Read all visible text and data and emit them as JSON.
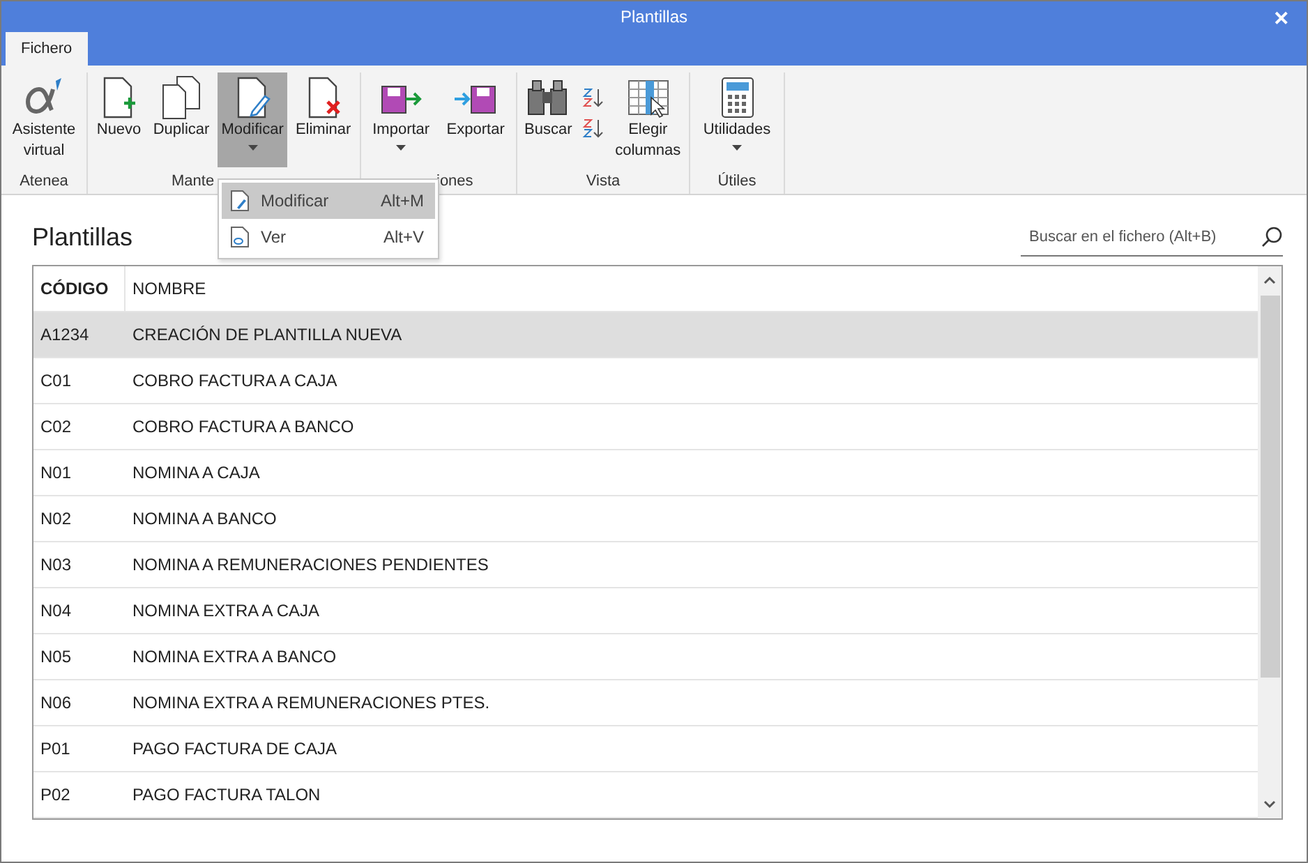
{
  "window": {
    "title": "Plantillas",
    "close": "✕"
  },
  "tabs": [
    {
      "label": "Fichero",
      "selected": true
    }
  ],
  "ribbon": {
    "groups": [
      {
        "label": "Atenea",
        "buttons": [
          {
            "kind": "alpha",
            "label": "Asistente virtual",
            "pressed": false,
            "dropdown": false
          }
        ]
      },
      {
        "label": "Mante",
        "buttons": [
          {
            "kind": "new",
            "label": "Nuevo",
            "pressed": false,
            "dropdown": false
          },
          {
            "kind": "copy",
            "label": "Duplicar",
            "pressed": false,
            "dropdown": false
          },
          {
            "kind": "edit",
            "label": "Modificar",
            "pressed": true,
            "dropdown": true
          },
          {
            "kind": "delete",
            "label": "Eliminar",
            "pressed": false,
            "dropdown": false
          }
        ]
      },
      {
        "label": "iones",
        "buttons": [
          {
            "kind": "import",
            "label": "Importar",
            "pressed": false,
            "dropdown": true
          },
          {
            "kind": "export",
            "label": "Exportar",
            "pressed": false,
            "dropdown": false
          }
        ]
      },
      {
        "label": "Vista",
        "buttons": [
          {
            "kind": "binoculars",
            "label": "Buscar",
            "pressed": false,
            "dropdown": false
          },
          {
            "kind": "sort"
          },
          {
            "kind": "columns",
            "label": "Elegir columnas",
            "pressed": false,
            "dropdown": false
          }
        ]
      },
      {
        "label": "Útiles",
        "buttons": [
          {
            "kind": "calculator",
            "label": "Utilidades",
            "pressed": false,
            "dropdown": true
          }
        ]
      }
    ]
  },
  "menu": [
    {
      "kind": "edit",
      "label": "Modificar",
      "shortcut": "Alt+M",
      "selected": true
    },
    {
      "kind": "view",
      "label": "Ver",
      "shortcut": "Alt+V",
      "selected": false
    }
  ],
  "heading": "Plantillas",
  "search": {
    "placeholder": "Buscar en el fichero (Alt+B)"
  },
  "table": {
    "columns": [
      "CÓDIGO",
      "NOMBRE"
    ],
    "rows": [
      {
        "code": "A1234",
        "name": "CREACIÓN DE PLANTILLA NUEVA",
        "selected": true
      },
      {
        "code": "C01",
        "name": "COBRO FACTURA A CAJA",
        "selected": false
      },
      {
        "code": "C02",
        "name": "COBRO FACTURA A BANCO",
        "selected": false
      },
      {
        "code": "N01",
        "name": "NOMINA A CAJA",
        "selected": false
      },
      {
        "code": "N02",
        "name": "NOMINA A BANCO",
        "selected": false
      },
      {
        "code": "N03",
        "name": "NOMINA A REMUNERACIONES PENDIENTES",
        "selected": false
      },
      {
        "code": "N04",
        "name": "NOMINA EXTRA A CAJA",
        "selected": false
      },
      {
        "code": "N05",
        "name": "NOMINA EXTRA A BANCO",
        "selected": false
      },
      {
        "code": "N06",
        "name": "NOMINA EXTRA A REMUNERACIONES PTES.",
        "selected": false
      },
      {
        "code": "P01",
        "name": "PAGO FACTURA DE CAJA",
        "selected": false
      },
      {
        "code": "P02",
        "name": "PAGO FACTURA TALON",
        "selected": false
      }
    ]
  }
}
